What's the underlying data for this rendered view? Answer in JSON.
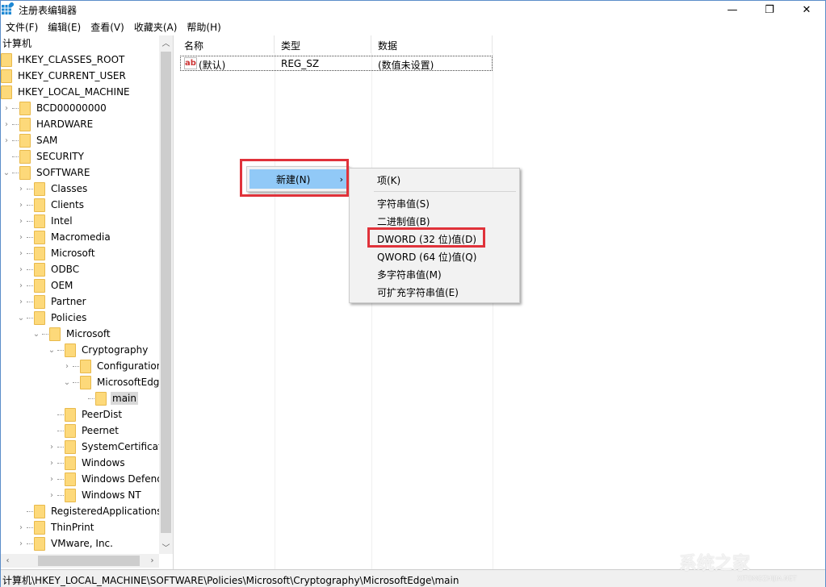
{
  "window": {
    "title": "注册表编辑器",
    "controls": {
      "minimize": "—",
      "restore": "❐",
      "close": "✕"
    }
  },
  "menubar": [
    "文件(F)",
    "编辑(E)",
    "查看(V)",
    "收藏夹(A)",
    "帮助(H)"
  ],
  "tree": {
    "root": "计算机",
    "nodes": [
      {
        "label": "HKEY_CLASSES_ROOT",
        "level": 0,
        "expander": ""
      },
      {
        "label": "HKEY_CURRENT_USER",
        "level": 0,
        "expander": ""
      },
      {
        "label": "HKEY_LOCAL_MACHINE",
        "level": 0,
        "expander": ""
      },
      {
        "label": "BCD00000000",
        "level": 1,
        "expander": "›"
      },
      {
        "label": "HARDWARE",
        "level": 1,
        "expander": "›"
      },
      {
        "label": "SAM",
        "level": 1,
        "expander": "›"
      },
      {
        "label": "SECURITY",
        "level": 1,
        "expander": ""
      },
      {
        "label": "SOFTWARE",
        "level": 1,
        "expander": "⌄"
      },
      {
        "label": "Classes",
        "level": 2,
        "expander": "›"
      },
      {
        "label": "Clients",
        "level": 2,
        "expander": "›"
      },
      {
        "label": "Intel",
        "level": 2,
        "expander": "›"
      },
      {
        "label": "Macromedia",
        "level": 2,
        "expander": "›"
      },
      {
        "label": "Microsoft",
        "level": 2,
        "expander": "›"
      },
      {
        "label": "ODBC",
        "level": 2,
        "expander": "›"
      },
      {
        "label": "OEM",
        "level": 2,
        "expander": "›"
      },
      {
        "label": "Partner",
        "level": 2,
        "expander": "›"
      },
      {
        "label": "Policies",
        "level": 2,
        "expander": "⌄"
      },
      {
        "label": "Microsoft",
        "level": 3,
        "expander": "⌄"
      },
      {
        "label": "Cryptography",
        "level": 4,
        "expander": "⌄"
      },
      {
        "label": "Configuration",
        "level": 5,
        "expander": "›"
      },
      {
        "label": "MicrosoftEdge",
        "level": 5,
        "expander": "⌄"
      },
      {
        "label": "main",
        "level": 6,
        "expander": "",
        "selected": true
      },
      {
        "label": "PeerDist",
        "level": 4,
        "expander": ""
      },
      {
        "label": "Peernet",
        "level": 4,
        "expander": ""
      },
      {
        "label": "SystemCertificates",
        "level": 4,
        "expander": "›"
      },
      {
        "label": "Windows",
        "level": 4,
        "expander": "›"
      },
      {
        "label": "Windows Defender",
        "level": 4,
        "expander": "›"
      },
      {
        "label": "Windows NT",
        "level": 4,
        "expander": "›"
      },
      {
        "label": "RegisteredApplications",
        "level": 2,
        "expander": ""
      },
      {
        "label": "ThinPrint",
        "level": 2,
        "expander": "›"
      },
      {
        "label": "VMware, Inc.",
        "level": 2,
        "expander": "›"
      }
    ]
  },
  "values_pane": {
    "columns": [
      "名称",
      "类型",
      "数据"
    ],
    "rows": [
      {
        "icon": "ab",
        "name": "(默认)",
        "type": "REG_SZ",
        "data": "(数值未设置)"
      }
    ]
  },
  "context_menu": {
    "new_label": "新建(N)",
    "new_arrow": "›",
    "submenu": [
      "项(K)",
      "字符串值(S)",
      "二进制值(B)",
      "DWORD (32 位)值(D)",
      "QWORD (64 位)值(Q)",
      "多字符串值(M)",
      "可扩充字符串值(E)"
    ]
  },
  "statusbar": {
    "path": "计算机\\HKEY_LOCAL_MACHINE\\SOFTWARE\\Policies\\Microsoft\\Cryptography\\MicrosoftEdge\\main"
  },
  "watermark": {
    "text": "系统之家",
    "sub": "XITONGZHIJIA.NET"
  },
  "colors": {
    "highlight": "#91c9f7",
    "annotation": "#e0323a",
    "folder": "#fdd97a"
  }
}
